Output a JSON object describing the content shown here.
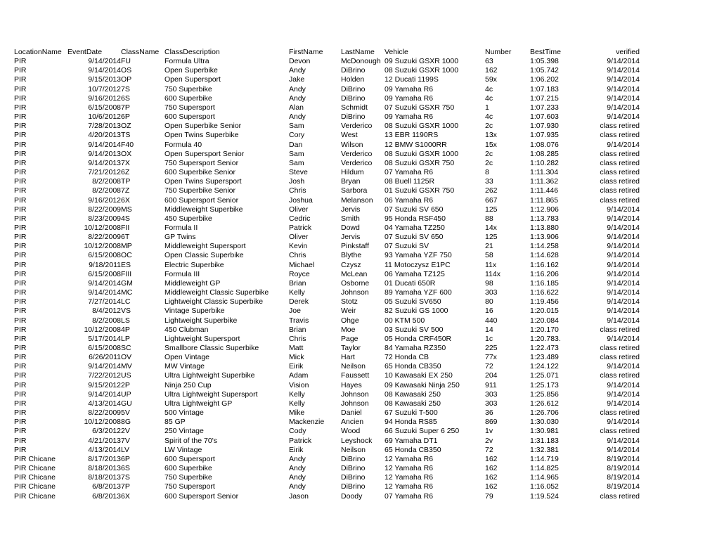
{
  "table": {
    "columns": [
      {
        "key": "LocationName",
        "label": "LocationName",
        "class": "c-location"
      },
      {
        "key": "EventDate",
        "label": "EventDate",
        "class": "c-date"
      },
      {
        "key": "ClassName",
        "label": "ClassName",
        "class": "c-class"
      },
      {
        "key": "ClassDescription",
        "label": "ClassDescription",
        "class": "c-desc"
      },
      {
        "key": "FirstName",
        "label": "FirstName",
        "class": "c-first"
      },
      {
        "key": "LastName",
        "label": "LastName",
        "class": "c-last"
      },
      {
        "key": "Vehicle",
        "label": "Vehicle",
        "class": "c-vehicle"
      },
      {
        "key": "Number",
        "label": "Number",
        "class": "c-number"
      },
      {
        "key": "BestTime",
        "label": "BestTime",
        "class": "c-besttime"
      },
      {
        "key": "verified",
        "label": "verified",
        "class": "c-verified"
      }
    ],
    "rows": [
      [
        "PIR",
        "9/14/2014",
        "FU",
        "Formula Ultra",
        "Devon",
        "McDonough",
        "09 Suzuki GSXR 1000",
        "63",
        "1:05.398",
        "9/14/2014"
      ],
      [
        "PIR",
        "9/14/2014",
        "OS",
        "Open Superbike",
        "Andy",
        "DiBrino",
        "08 Suzuki GSXR 1000",
        "162",
        "1:05.742",
        "9/14/2014"
      ],
      [
        "PIR",
        "9/15/2013",
        "OP",
        "Open Supersport",
        "Jake",
        "Holden",
        "12 Ducati 1199S",
        "59x",
        "1:06.202",
        "9/14/2014"
      ],
      [
        "PIR",
        "10/7/2012",
        "7S",
        "750 Superbike",
        "Andy",
        "DiBrino",
        "09 Yamaha R6",
        "4c",
        "1:07.183",
        "9/14/2014"
      ],
      [
        "PIR",
        "9/16/2012",
        "6S",
        "600 Superbike",
        "Andy",
        "DiBrino",
        "09 Yamaha R6",
        "4c",
        "1:07.215",
        "9/14/2014"
      ],
      [
        "PIR",
        "6/15/2008",
        "7P",
        "750 Supersport",
        "Alan",
        "Schmidt",
        "07 Suzuki GSXR 750",
        "1",
        "1:07.233",
        "9/14/2014"
      ],
      [
        "PIR",
        "10/6/2012",
        "6P",
        "600 Supersport",
        "Andy",
        "DiBrino",
        "09 Yamaha R6",
        "4c",
        "1:07.603",
        "9/14/2014"
      ],
      [
        "PIR",
        "7/28/2013",
        "OZ",
        "Open Superbike Senior",
        "Sam",
        "Verderico",
        "08 Suzuki GSXR 1000",
        "2c",
        "1:07.930",
        "class retired"
      ],
      [
        "PIR",
        "4/20/2013",
        "TS",
        "Open Twins Superbike",
        "Cory",
        "West",
        "13 EBR 1190RS",
        "13x",
        "1:07.935",
        "class retired"
      ],
      [
        "PIR",
        "9/14/2014",
        "F40",
        "Formula 40",
        "Dan",
        "Wilson",
        "12 BMW S1000RR",
        "15x",
        "1:08.076",
        "9/14/2014"
      ],
      [
        "PIR",
        "9/14/2013",
        "OX",
        "Open Supersport Senior",
        "Sam",
        "Verderico",
        "08 Suzuki GSXR 1000",
        "2c",
        "1:08.285",
        "class retired"
      ],
      [
        "PIR",
        "9/14/2013",
        "7X",
        "750 Supersport Senior",
        "Sam",
        "Verderico",
        "08 Suzuki GSXR 750",
        "2c",
        "1:10.282",
        "class retired"
      ],
      [
        "PIR",
        "7/21/2012",
        "6Z",
        "600 Superbike Senior",
        "Steve",
        "Hildum",
        "07 Yamaha R6",
        "8",
        "1:11.304",
        "class retired"
      ],
      [
        "PIR",
        "8/2/2008",
        "TP",
        "Open Twins Supersport",
        "Josh",
        "Bryan",
        "08 Buell 1125R",
        "33",
        "1:11.362",
        "class retired"
      ],
      [
        "PIR",
        "8/2/2008",
        "7Z",
        "750 Superbike Senior",
        "Chris",
        "Sarbora",
        "01 Suzuki GSXR 750",
        "262",
        "1:11.446",
        "class retired"
      ],
      [
        "PIR",
        "9/16/2012",
        "6X",
        "600 Supersport Senior",
        "Joshua",
        "Melanson",
        "06 Yamaha R6",
        "667",
        "1:11.865",
        "class retired"
      ],
      [
        "PIR",
        "8/22/2009",
        "MS",
        "Middleweight Superbike",
        "Oliver",
        "Jervis",
        "07 Suzuki SV 650",
        "125",
        "1:12.906",
        "9/14/2014"
      ],
      [
        "PIR",
        "8/23/2009",
        "4S",
        "450 Superbike",
        "Cedric",
        "Smith",
        "95 Honda RSF450",
        "88",
        "1:13.783",
        "9/14/2014"
      ],
      [
        "PIR",
        "10/12/2008",
        "FII",
        "Formula II",
        "Patrick",
        "Dowd",
        "04 Yamaha TZ250",
        "14x",
        "1:13.880",
        "9/14/2014"
      ],
      [
        "PIR",
        "8/22/2009",
        "6T",
        "GP Twins",
        "Oliver",
        "Jervis",
        "07 Suzuki SV 650",
        "125",
        "1:13.906",
        "9/14/2014"
      ],
      [
        "PIR",
        "10/12/2008",
        "MP",
        "Middleweight Supersport",
        "Kevin",
        "Pinkstaff",
        "07 Suzuki SV",
        "21",
        "1:14.258",
        "9/14/2014"
      ],
      [
        "PIR",
        "6/15/2008",
        "OC",
        "Open Classic Superbike",
        "Chris",
        "Blythe",
        "93 Yamaha YZF 750",
        "58",
        "1:14.628",
        "9/14/2014"
      ],
      [
        "PIR",
        "9/18/2011",
        "ES",
        "Electric Superbike",
        "Michael",
        "Czysz",
        "11 Motoczysz E1PC",
        "11x",
        "1:16.162",
        "9/14/2014"
      ],
      [
        "PIR",
        "6/15/2008",
        "FIII",
        "Formula III",
        "Royce",
        "McLean",
        "06 Yamaha TZ125",
        "114x",
        "1:16.206",
        "9/14/2014"
      ],
      [
        "PIR",
        "9/14/2014",
        "GM",
        "Middleweight GP",
        "Brian",
        "Osborne",
        "01 Ducati 650R",
        "98",
        "1:16.185",
        "9/14/2014"
      ],
      [
        "PIR",
        "9/14/2014",
        "MC",
        "Middleweight Classic Superbike",
        "Kelly",
        "Johnson",
        "89 Yamaha YZF 600",
        "303",
        "1:16.622",
        "9/14/2014"
      ],
      [
        "PIR",
        "7/27/2014",
        "LC",
        "Lightweight Classic Superbike",
        "Derek",
        "Stotz",
        "05 Suzuki SV650",
        "80",
        "1:19.456",
        "9/14/2014"
      ],
      [
        "PIR",
        "8/4/2012",
        "VS",
        "Vintage Superbike",
        "Joe",
        "Weir",
        "82 Suzuki GS 1000",
        "16",
        "1:20.015",
        "9/14/2014"
      ],
      [
        "PIR",
        "8/2/2008",
        "LS",
        "Lightweight Superbike",
        "Travis",
        "Ohge",
        "00 KTM 500",
        "440",
        "1:20.084",
        "9/14/2014"
      ],
      [
        "PIR",
        "10/12/2008",
        "4P",
        "450 Clubman",
        "Brian",
        "Moe",
        "03 Suzuki SV 500",
        "14",
        "1:20.170",
        "class retired"
      ],
      [
        "PIR",
        "5/17/2014",
        "LP",
        "Lightweight Supersport",
        "Chris",
        "Page",
        "05 Honda CRF450R",
        "1c",
        "1:20.783.",
        "9/14/2014"
      ],
      [
        "PIR",
        "6/15/2008",
        "SC",
        "Smallbore Classic Superbike",
        "Matt",
        "Taylor",
        "84 Yamaha RZ350",
        "225",
        "1:22.473",
        "class retired"
      ],
      [
        "PIR",
        "6/26/2011",
        "OV",
        "Open Vintage",
        "Mick",
        "Hart",
        "72 Honda CB",
        "77x",
        "1:23.489",
        "class retired"
      ],
      [
        "PIR",
        "9/14/2014",
        "MV",
        "MW Vintage",
        "Eirik",
        "Neilson",
        "65 Honda CB350",
        "72",
        "1:24.122",
        "9/14/2014"
      ],
      [
        "PIR",
        "7/22/2012",
        "US",
        "Ultra Lightweight Superbike",
        "Adam",
        "Faussett",
        "10 Kawasaki EX 250",
        "204",
        "1:25.071",
        "class retired"
      ],
      [
        "PIR",
        "9/15/2012",
        "2P",
        "Ninja 250 Cup",
        "Vision",
        "Hayes",
        "09 Kawasaki Ninja 250",
        "911",
        "1:25.173",
        "9/14/2014"
      ],
      [
        "PIR",
        "9/14/2014",
        "UP",
        "Ultra Lightweight Supersport",
        "Kelly",
        "Johnson",
        "08 Kawasaki 250",
        "303",
        "1:25.856",
        "9/14/2014"
      ],
      [
        "PIR",
        "4/13/2014",
        "GU",
        "Ultra Lightweight GP",
        "Kelly",
        "Johnson",
        "08 Kawasaki 250",
        "303",
        "1:26.612",
        "9/14/2014"
      ],
      [
        "PIR",
        "8/22/2009",
        "5V",
        "500 Vintage",
        "Mike",
        "Daniel",
        "67 Suzuki T-500",
        "36",
        "1:26.706",
        "class retired"
      ],
      [
        "PIR",
        "10/12/2008",
        "8G",
        "85 GP",
        "Mackenzie",
        "Ancien",
        "94 Honda RS85",
        "869",
        "1:30.030",
        "9/14/2014"
      ],
      [
        "PIR",
        "6/3/2012",
        "2V",
        "250 Vintage",
        "Cody",
        "Wood",
        "66 Suzuki Super 6 250",
        "1v",
        "1:30.981",
        "class retired"
      ],
      [
        "PIR",
        "4/21/2013",
        "7V",
        "Spirit of the 70's",
        "Patrick",
        "Leyshock",
        "69 Yamaha DT1",
        "2v",
        "1:31.183",
        "9/14/2014"
      ],
      [
        "PIR",
        "4/13/2014",
        "LV",
        "LW Vintage",
        "Eirik",
        "Neilson",
        "65 Honda CB350",
        "72",
        "1:32.381",
        "9/14/2014"
      ],
      [
        "PIR Chicane",
        "8/17/2013",
        "6P",
        "600 Supersport",
        "Andy",
        "DiBrino",
        "12 Yamaha R6",
        "162",
        "1:14.719",
        "8/19/2014"
      ],
      [
        "PIR Chicane",
        "8/18/2013",
        "6S",
        "600 Superbike",
        "Andy",
        "DiBrino",
        "12 Yamaha R6",
        "162",
        "1:14.825",
        "8/19/2014"
      ],
      [
        "PIR Chicane",
        "8/18/2013",
        "7S",
        "750 Superbike",
        "Andy",
        "DiBrino",
        "12 Yamaha R6",
        "162",
        "1:14.965",
        "8/19/2014"
      ],
      [
        "PIR Chicane",
        "6/8/2013",
        "7P",
        "750 Supersport",
        "Andy",
        "DiBrino",
        "12 Yamaha R6",
        "162",
        "1:16.052",
        "8/19/2014"
      ],
      [
        "PIR Chicane",
        "6/8/2013",
        "6X",
        "600 Supersport Senior",
        "Jason",
        "Doody",
        "07 Yamaha R6",
        "79",
        "1:19.524",
        "class retired"
      ]
    ]
  }
}
